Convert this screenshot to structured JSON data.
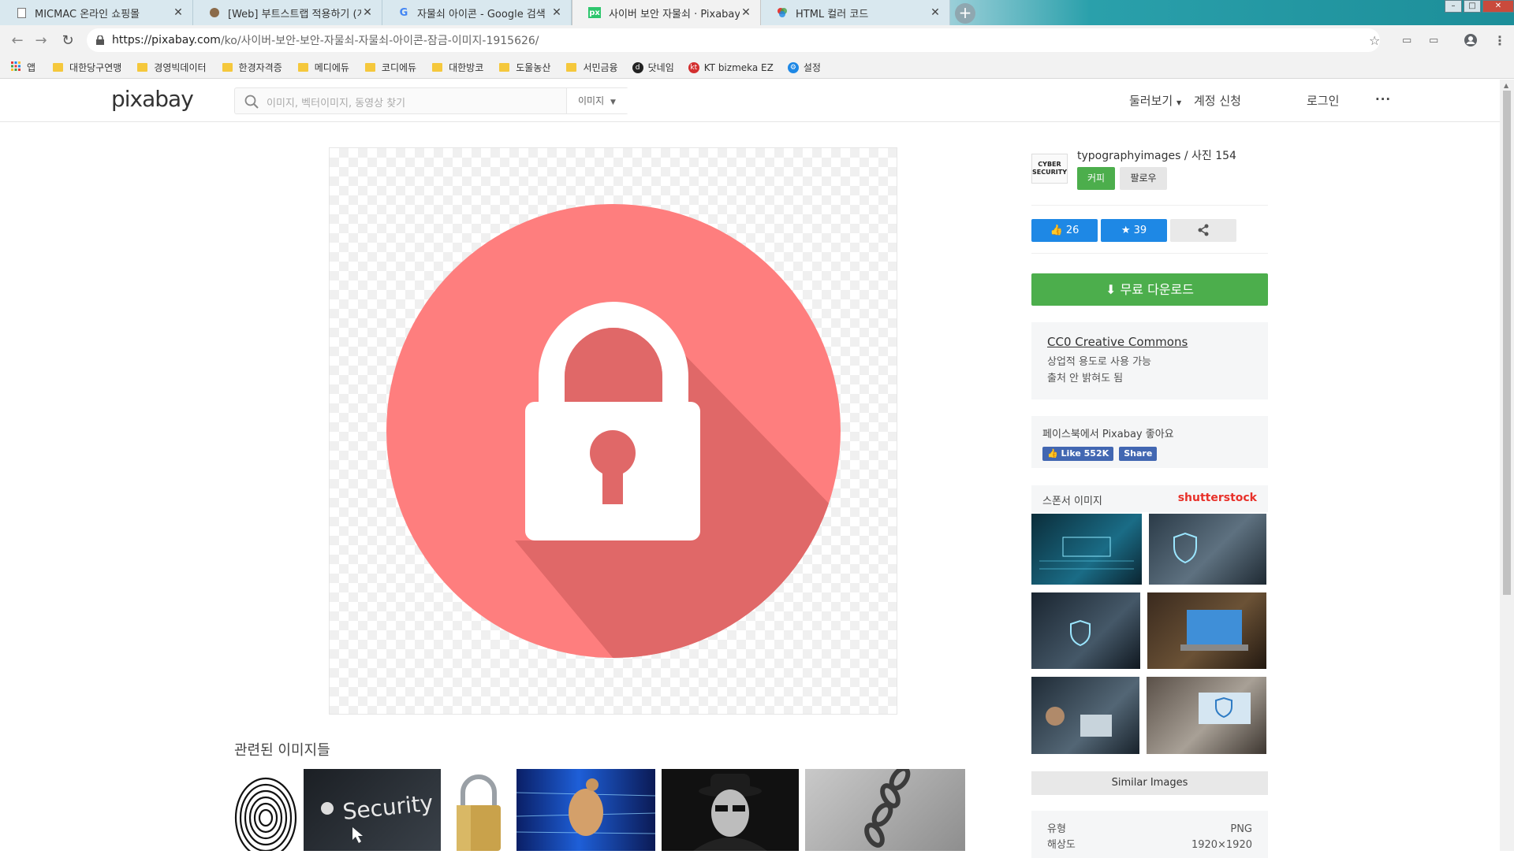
{
  "browser": {
    "tabs": [
      {
        "title": "MICMAC 온라인 쇼핑몰",
        "active": false
      },
      {
        "title": "[Web] 부트스트랩 적용하기 (게",
        "active": false
      },
      {
        "title": "자물쇠 아이콘 - Google 검색",
        "active": false
      },
      {
        "title": "사이버 보안 자물쇠 · Pixabay의",
        "active": true
      },
      {
        "title": "HTML 컬러 코드",
        "active": false
      }
    ],
    "url_host": "https://pixabay.com",
    "url_path": "/ko/사이버-보안-보안-자물쇠-자물쇠-아이콘-잠금-이미지-1915626/",
    "bookmarks": [
      {
        "label": "앱",
        "icon": "apps-grid-icon"
      },
      {
        "label": "대한당구연맹",
        "icon": "folder-icon"
      },
      {
        "label": "경영빅데이터",
        "icon": "folder-icon"
      },
      {
        "label": "한경자격증",
        "icon": "folder-icon"
      },
      {
        "label": "메디에듀",
        "icon": "folder-icon"
      },
      {
        "label": "코디에듀",
        "icon": "folder-icon"
      },
      {
        "label": "대한방코",
        "icon": "folder-icon"
      },
      {
        "label": "도울농산",
        "icon": "folder-icon"
      },
      {
        "label": "서민금융",
        "icon": "folder-icon"
      },
      {
        "label": "닷네임",
        "icon": "dotname-icon"
      },
      {
        "label": "KT bizmeka EZ",
        "icon": "kt-icon"
      },
      {
        "label": "설정",
        "icon": "gear-icon"
      }
    ]
  },
  "header": {
    "logo": "pixabay",
    "search_placeholder": "이미지, 벡터이미지, 동영상 찾기",
    "search_type": "이미지",
    "nav": {
      "explore": "둘러보기",
      "signup": "계정 신청",
      "login": "로그인",
      "more": "···"
    }
  },
  "main": {
    "related_title": "관련된 이미지들",
    "colors": {
      "circle": "#fe7e7e",
      "shadow": "#e06868",
      "lock": "#ffffff"
    }
  },
  "sidebar": {
    "avatar_text": "CYBER SECURITY",
    "user_name": "typographyimages",
    "user_stats": "/ 사진 154",
    "coffee_label": "커피",
    "follow_label": "팔로우",
    "likes": "26",
    "favorites": "39",
    "download_label": "무료 다운로드",
    "license_title": "CC0 Creative Commons",
    "license_line1": "상업적 용도로 사용 가능",
    "license_line2": "출처 안 밝혀도 됨",
    "facebook_text": "페이스북에서 Pixabay 좋아요",
    "fb_like": "Like 552K",
    "fb_share": "Share",
    "sponsor_label": "스폰서 이미지",
    "sponsor_brand": "shutterstock",
    "similar_label": "Similar Images",
    "info": {
      "type_label": "유형",
      "type_value": "PNG",
      "res_label": "해상도",
      "res_value": "1920×1920"
    }
  }
}
